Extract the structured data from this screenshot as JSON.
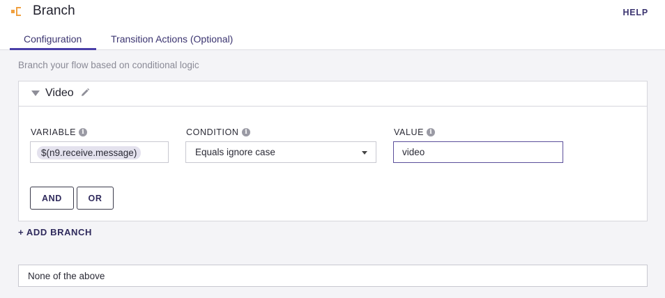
{
  "header": {
    "title": "Branch",
    "help_label": "HELP",
    "logo_icon": "branch-widget-icon",
    "accent_color": "#f0a040"
  },
  "tabs": [
    {
      "label": "Configuration",
      "active": true
    },
    {
      "label": "Transition Actions (Optional)",
      "active": false
    }
  ],
  "subtitle": "Branch your flow based on conditional logic",
  "branch": {
    "name": "Video",
    "collapse_icon": "caret-down-icon",
    "edit_icon": "pencil-icon",
    "variable": {
      "label": "VARIABLE",
      "value": "$(n9.receive.message)"
    },
    "condition": {
      "label": "CONDITION",
      "value": "Equals ignore case"
    },
    "value": {
      "label": "VALUE",
      "value": "video"
    },
    "and_label": "AND",
    "or_label": "OR"
  },
  "add_branch_label": "+ ADD BRANCH",
  "default_branch": "None of the above",
  "colors": {
    "primary": "#3b3470",
    "tab_underline": "#4a3fa8",
    "background": "#f4f4f7"
  }
}
